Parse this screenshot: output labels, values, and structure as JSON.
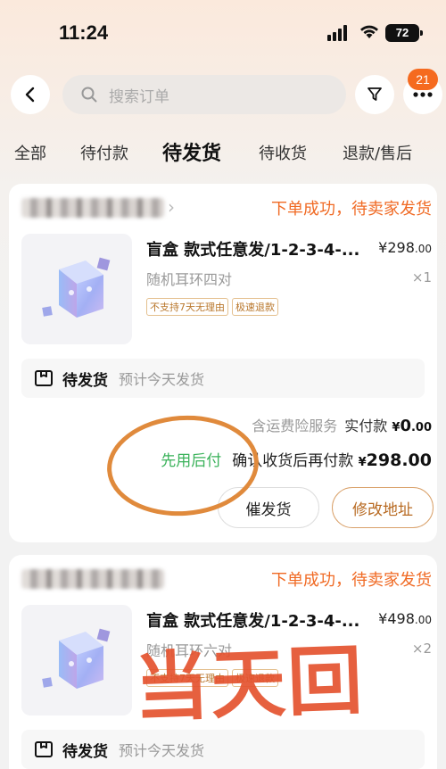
{
  "status_bar": {
    "time": "11:24",
    "battery": "72"
  },
  "header": {
    "search_placeholder": "搜索订单",
    "notification_count": "21"
  },
  "tabs": [
    {
      "label": "全部"
    },
    {
      "label": "待付款"
    },
    {
      "label": "待发货",
      "active": true
    },
    {
      "label": "待收货"
    },
    {
      "label": "退款/售后"
    }
  ],
  "orders": [
    {
      "shop_name": "",
      "status": "下单成功，待卖家发货",
      "title": "盲盒 款式任意发/1-2-3-4-...",
      "price_currency": "¥",
      "price_main": "298",
      "price_decimal": ".00",
      "spec": "随机耳环四对",
      "qty": "×1",
      "tags": [
        "不支持7天无理由",
        "极速退款"
      ],
      "ship_label": "待发货",
      "ship_sub": "预计今天发货",
      "fee_text": "含运费险服务",
      "paid_label": "实付款",
      "paid_currency": "¥",
      "paid_main": "0",
      "paid_decimal": ".00",
      "pay_later": "先用后付",
      "pay_later_desc": "确认收货后再付款",
      "pay_currency": "¥",
      "pay_amount": "298.00",
      "btn_urge": "催发货",
      "btn_address": "修改地址"
    },
    {
      "shop_name": "",
      "status": "下单成功，待卖家发货",
      "title": "盲盒 款式任意发/1-2-3-4-...",
      "price_currency": "¥",
      "price_main": "498",
      "price_decimal": ".00",
      "spec": "随机耳环六对",
      "qty": "×2",
      "tags": [
        "不支持7天无理由",
        "极速退款"
      ],
      "ship_label": "待发货",
      "ship_sub": "预计今天发货"
    }
  ],
  "overlay": {
    "text": "当天回"
  },
  "colors": {
    "accent": "#f06a24",
    "green": "#3ab25a",
    "annotation": "#e08a3c",
    "overlay": "#e4532f"
  }
}
